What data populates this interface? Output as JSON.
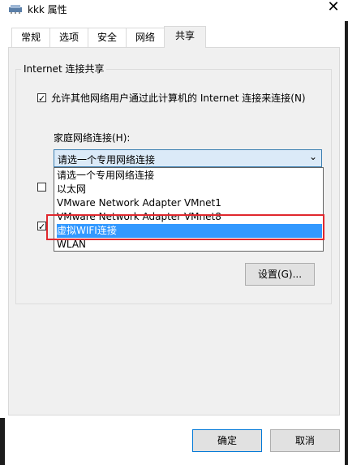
{
  "window": {
    "title": "kkk 属性",
    "close_glyph": "✕",
    "icon": "network-icon"
  },
  "tabs": [
    {
      "label": "常规",
      "active": false
    },
    {
      "label": "选项",
      "active": false
    },
    {
      "label": "安全",
      "active": false
    },
    {
      "label": "网络",
      "active": false
    },
    {
      "label": "共享",
      "active": true
    }
  ],
  "sharing": {
    "group_title": "Internet 连接共享",
    "allow_checkbox": {
      "label": "允许其他网络用户通过此计算机的 Internet 连接来连接(N)",
      "checked": true
    },
    "home_network_label": "家庭网络连接(H):",
    "combo": {
      "value": "请选一个专用网络连接"
    },
    "options": [
      "请选一个专用网络连接",
      "以太网",
      "VMware Network Adapter VMnet1",
      "VMware Network Adapter VMnet8",
      "虚拟WIFI连接",
      "WLAN"
    ],
    "selected_option": "虚拟WIFI连接",
    "settings_button": "设置(G)..."
  },
  "buttons": {
    "ok": "确定",
    "cancel": "取消"
  },
  "colors": {
    "highlight": "#3399ff",
    "annotation": "#e0282e",
    "panel": "#f0f0f0"
  }
}
